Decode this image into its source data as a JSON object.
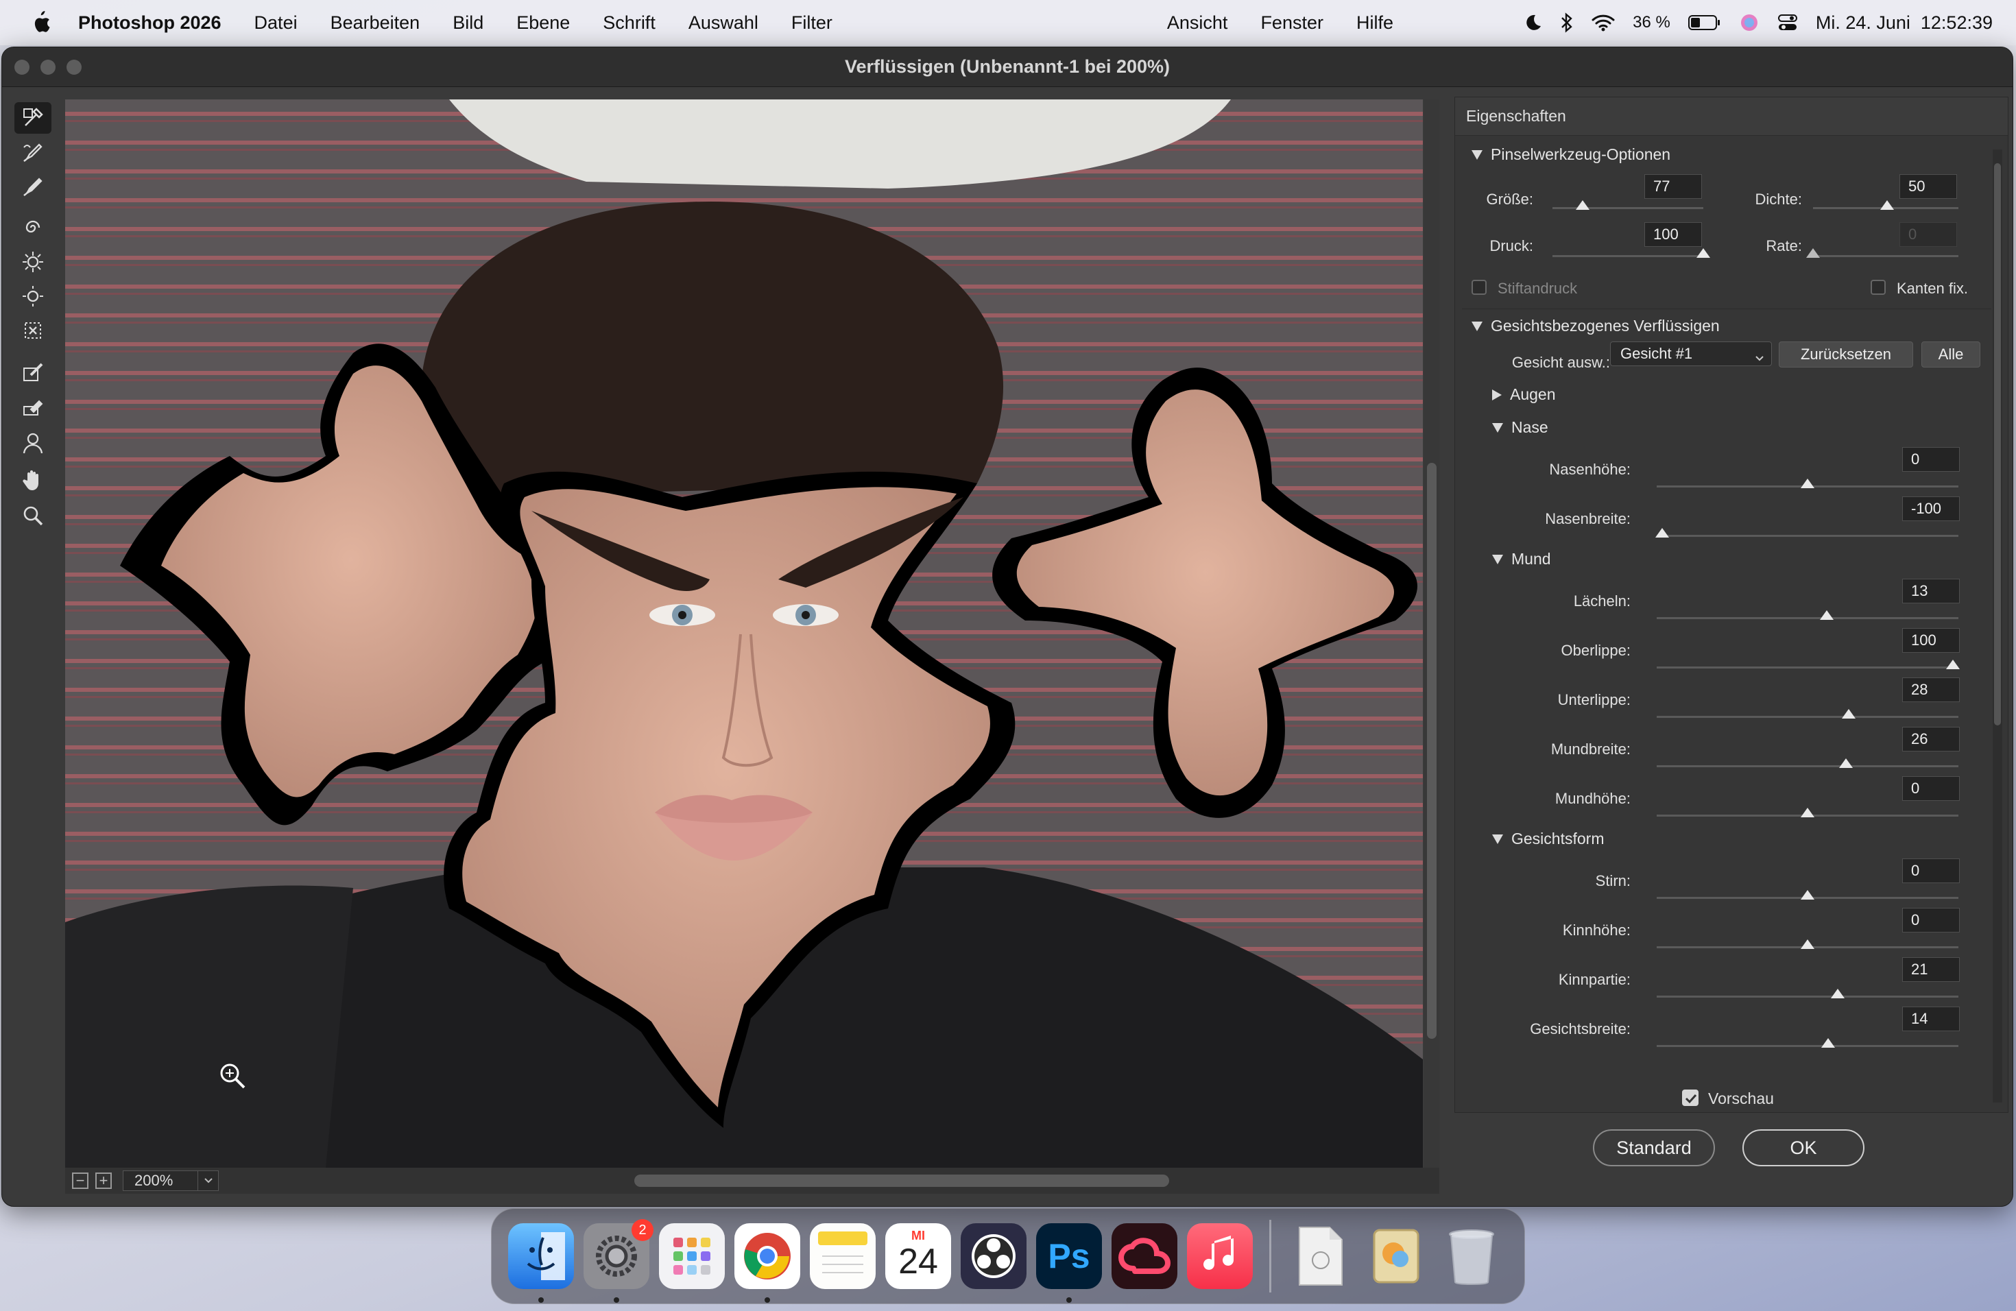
{
  "menubar": {
    "app_name": "Photoshop 2026",
    "items": [
      "Datei",
      "Bearbeiten",
      "Bild",
      "Ebene",
      "Schrift",
      "Auswahl",
      "Filter",
      "Ansicht",
      "Fenster",
      "Hilfe"
    ],
    "battery": "36 %",
    "clock": "Mi. 24. Juni  12:52:39"
  },
  "window": {
    "title": "Verflüssigen (Unbenannt-1 bei 200%)"
  },
  "canvas": {
    "zoom": "200%"
  },
  "panel": {
    "header": "Eigenschaften",
    "brush": {
      "title": "Pinselwerkzeug-Optionen",
      "groesse_label": "Größe:",
      "groesse": "77",
      "dichte_label": "Dichte:",
      "dichte": "50",
      "druck_label": "Druck:",
      "druck": "100",
      "rate_label": "Rate:",
      "rate": "0",
      "stiftandruck": "Stiftandruck",
      "kanten": "Kanten fix."
    },
    "face": {
      "title": "Gesichtsbezogenes Verflüssigen",
      "select_label": "Gesicht ausw.:",
      "selected_face": "Gesicht #1",
      "reset": "Zurücksetzen",
      "all": "Alle",
      "augen": "Augen",
      "nase": "Nase",
      "nasenhoehe_label": "Nasenhöhe:",
      "nasenhoehe": "0",
      "nasenbreite_label": "Nasenbreite:",
      "nasenbreite": "-100",
      "mund": "Mund",
      "laecheln_label": "Lächeln:",
      "laecheln": "13",
      "oberlippe_label": "Oberlippe:",
      "oberlippe": "100",
      "unterlippe_label": "Unterlippe:",
      "unterlippe": "28",
      "mundbreite_label": "Mundbreite:",
      "mundbreite": "26",
      "mundhoehe_label": "Mundhöhe:",
      "mundhoehe": "0",
      "gesichtsform": "Gesichtsform",
      "stirn_label": "Stirn:",
      "stirn": "0",
      "kinnhoehe_label": "Kinnhöhe:",
      "kinnhoehe": "0",
      "kinnpartie_label": "Kinnpartie:",
      "kinnpartie": "21",
      "gesichtsbreite_label": "Gesichtsbreite:",
      "gesichtsbreite": "14"
    },
    "vorschau": "Vorschau",
    "standard": "Standard",
    "ok": "OK"
  },
  "dock": {
    "calendar_month": "MI",
    "calendar_day": "24",
    "settings_badge": "2",
    "ps_label": "Ps"
  },
  "colors": {
    "accent": "#2f7cf6",
    "panel_bg": "#363636",
    "ps_blue": "#31a8ff"
  }
}
